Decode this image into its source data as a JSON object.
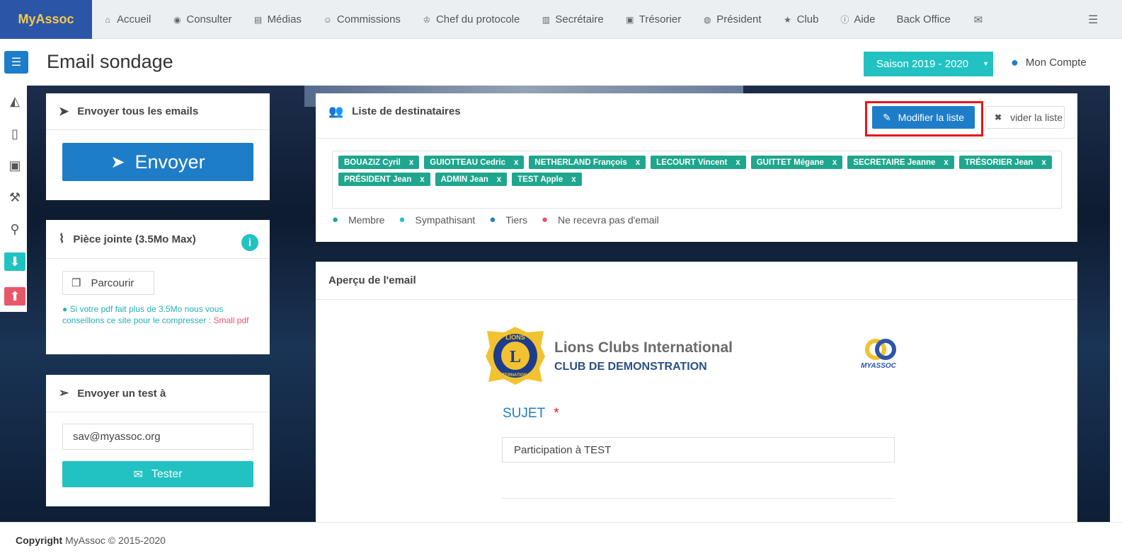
{
  "brand": "MyAssoc",
  "nav": [
    {
      "label": "Accueil",
      "icon": "home-icon",
      "glyph": "⌂"
    },
    {
      "label": "Consulter",
      "icon": "eye-icon",
      "glyph": "◉"
    },
    {
      "label": "Médias",
      "icon": "file-icon",
      "glyph": "▤"
    },
    {
      "label": "Commissions",
      "icon": "user-circle-icon",
      "glyph": "☺"
    },
    {
      "label": "Chef du protocole",
      "icon": "trophy-icon",
      "glyph": "♔"
    },
    {
      "label": "Secrétaire",
      "icon": "book-icon",
      "glyph": "▥"
    },
    {
      "label": "Trésorier",
      "icon": "money-icon",
      "glyph": "▣"
    },
    {
      "label": "Président",
      "icon": "globe-icon",
      "glyph": "◍"
    },
    {
      "label": "Club",
      "icon": "star-icon",
      "glyph": "★"
    },
    {
      "label": "Aide",
      "icon": "info-icon",
      "glyph": "ⓘ"
    },
    {
      "label": "Back Office",
      "icon": "",
      "glyph": ""
    },
    {
      "label": "",
      "icon": "envelope-icon",
      "glyph": "✉"
    }
  ],
  "page": {
    "title": "Email sondage"
  },
  "season": "Saison 2019 - 2020",
  "account": "Mon Compte",
  "send_all": {
    "title": "Envoyer tous les emails",
    "button": "Envoyer"
  },
  "attachment": {
    "title": "Pièce jointe (3.5Mo Max)",
    "browse": "Parcourir",
    "hint": "Si votre pdf fait plus de 3.5Mo nous vous conseillons ce site pour le compresser : ",
    "hint_link": "Small pdf"
  },
  "test": {
    "title": "Envoyer un test à",
    "email": "sav@myassoc.org",
    "button": "Tester"
  },
  "recipients": {
    "title": "Liste de destinataires",
    "modify": "Modifier la liste",
    "clear": "vider la liste",
    "tags": [
      "BOUAZIZ Cyril",
      "GUIOTTEAU Cedric",
      "NETHERLAND François",
      "LECOURT Vincent",
      "GUITTET Mégane",
      "SECRETAIRE Jeanne",
      "TRÉSORIER Jean",
      "PRÉSIDENT Jean",
      "ADMIN Jean",
      "TEST Apple"
    ],
    "remove": "x",
    "legend": [
      {
        "label": "Membre",
        "color": "#1fa68e"
      },
      {
        "label": "Sympathisant",
        "color": "#22c2c2"
      },
      {
        "label": "Tiers",
        "color": "#1e7dc8"
      },
      {
        "label": "Ne recevra pas d'email",
        "color": "#e8566a"
      }
    ]
  },
  "preview": {
    "title": "Aperçu de l'email",
    "org": "Lions Clubs International",
    "club": "CLUB DE DEMONSTRATION",
    "lions_logo_text": {
      "top": "LIONS",
      "letter": "L",
      "bottom": "INTERNATIONAL"
    },
    "myassoc_logo_text": "MYASSOC",
    "subject_label": "SUJET",
    "required_mark": "*",
    "subject_value": "Participation à TEST"
  },
  "footer": {
    "copyright": "Copyright",
    "text": "MyAssoc © 2015-2020"
  },
  "colors": {
    "primary": "#1e7dc8",
    "teal": "#22c2c2",
    "member": "#1fa68e",
    "danger": "#e8566a",
    "brand_bg": "#2b56a8",
    "brand_text": "#f7c948",
    "highlight": "#e8141c"
  }
}
